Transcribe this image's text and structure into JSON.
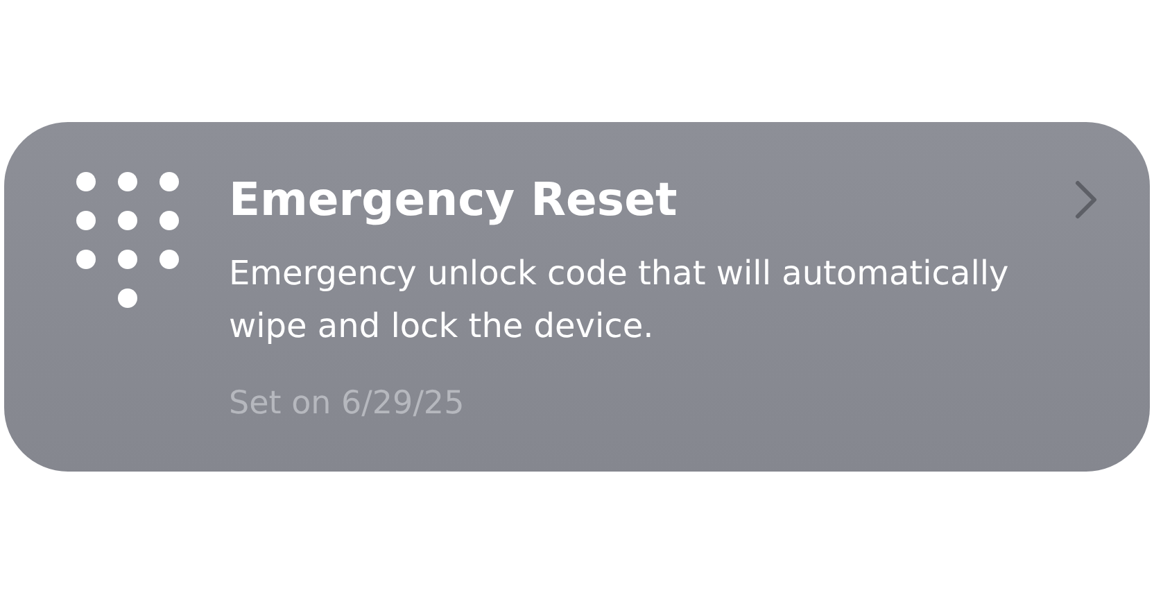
{
  "card": {
    "title": "Emergency Reset",
    "description": "Emergency unlock code that will automatically wipe and lock the device.",
    "date": "Set on 6/29/25"
  }
}
